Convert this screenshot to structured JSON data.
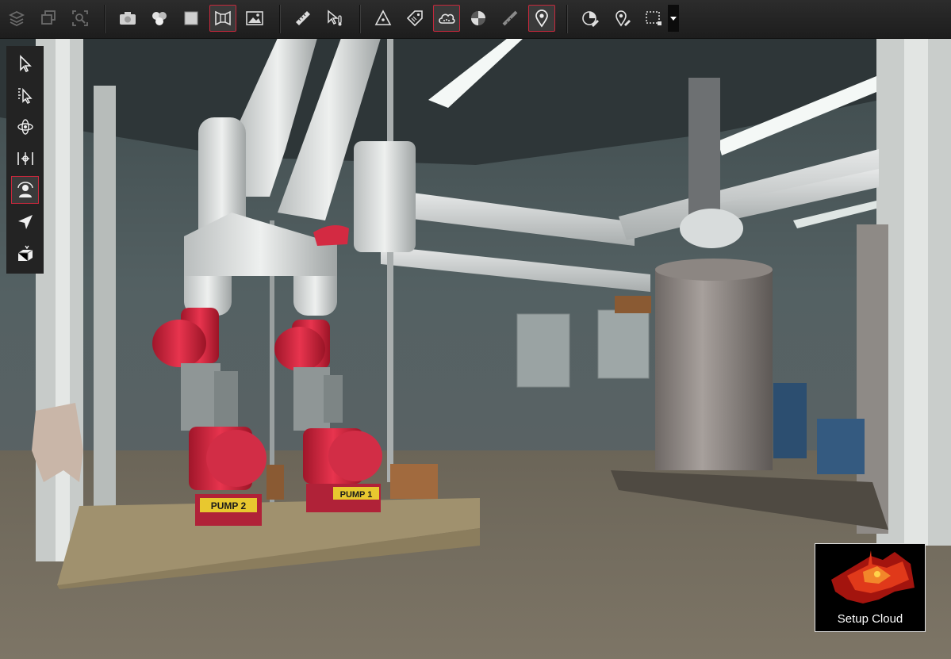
{
  "toolbar": {
    "groups": [
      {
        "name": "view",
        "items": [
          {
            "icon": "layers-icon",
            "active": false
          },
          {
            "icon": "window-stack-icon",
            "active": false
          },
          {
            "icon": "zoom-fit-icon",
            "active": false
          }
        ]
      },
      {
        "name": "display",
        "items": [
          {
            "icon": "camera-icon",
            "active": false
          },
          {
            "icon": "scans-icon",
            "active": false
          },
          {
            "icon": "square-icon",
            "active": false
          },
          {
            "icon": "panorama-icon",
            "active": true
          },
          {
            "icon": "image-icon",
            "active": false
          }
        ]
      },
      {
        "name": "measure",
        "items": [
          {
            "icon": "ruler-icon",
            "active": false
          },
          {
            "icon": "pick-thermometer-icon",
            "active": false
          }
        ]
      },
      {
        "name": "annotate",
        "items": [
          {
            "icon": "triangle-icon",
            "active": false
          },
          {
            "icon": "tag-icon",
            "active": false
          },
          {
            "icon": "cloud-icon",
            "active": true
          },
          {
            "icon": "half-disc-icon",
            "active": false
          },
          {
            "icon": "scale-bar-icon",
            "active": false
          },
          {
            "icon": "location-pin-icon",
            "active": true
          }
        ]
      },
      {
        "name": "tools",
        "items": [
          {
            "icon": "pie-edit-icon",
            "active": false
          },
          {
            "icon": "pin-edit-icon",
            "active": false
          },
          {
            "icon": "selection-box-icon",
            "active": false
          }
        ]
      }
    ],
    "accent_color": "#c8283c"
  },
  "palette": {
    "items": [
      {
        "icon": "select-arrow-icon",
        "active": false
      },
      {
        "icon": "select-area-arrow-icon",
        "active": false
      },
      {
        "icon": "orbit-icon",
        "active": false
      },
      {
        "icon": "pan-vertical-icon",
        "active": false
      },
      {
        "icon": "walk-person-icon",
        "active": true
      },
      {
        "icon": "fly-send-icon",
        "active": false
      },
      {
        "icon": "box-clip-icon",
        "active": false
      }
    ]
  },
  "scene": {
    "pump_labels": [
      "PUMP 2",
      "PUMP 1"
    ]
  },
  "cloud_card": {
    "label": "Setup Cloud"
  }
}
